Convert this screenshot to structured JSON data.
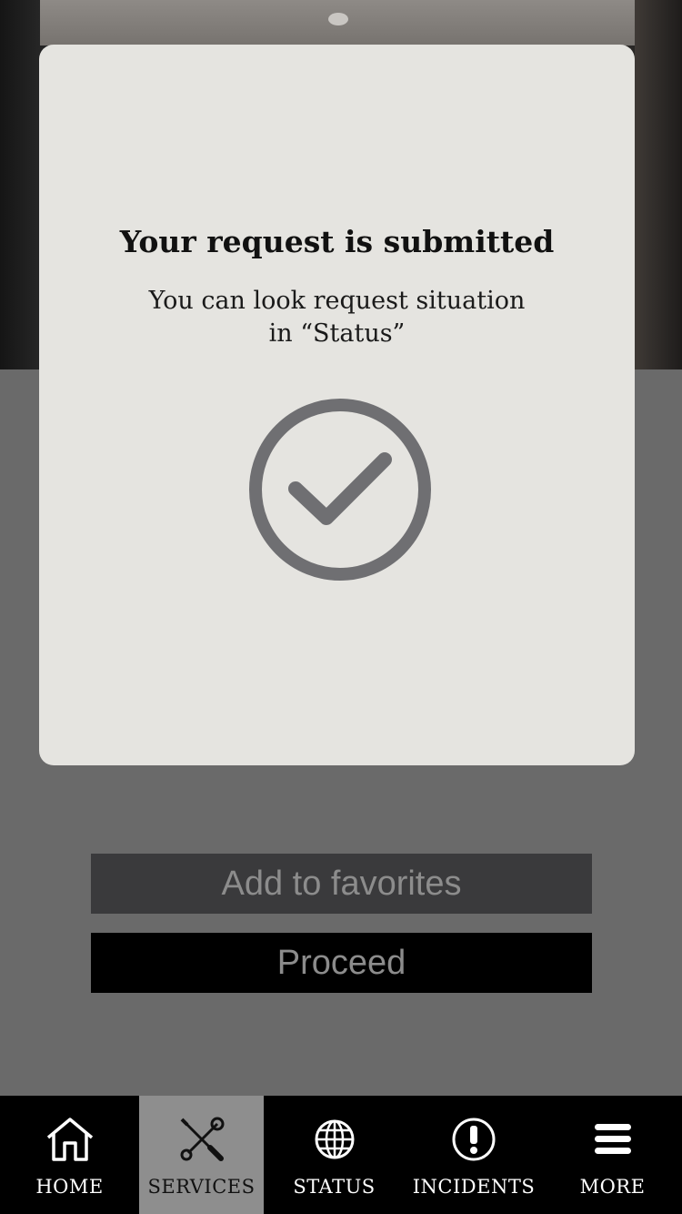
{
  "modal": {
    "title": "Your request is submitted",
    "message_line1": "You can look request situation",
    "message_line2": "in “Status”",
    "icon": "check-circle-icon"
  },
  "actions": {
    "favorites_label": "Add to favorites",
    "proceed_label": "Proceed"
  },
  "tabbar": {
    "items": [
      {
        "label": "HOME",
        "icon": "home-icon"
      },
      {
        "label": "SERVICES",
        "icon": "tools-icon",
        "active": true
      },
      {
        "label": "STATUS",
        "icon": "globe-icon"
      },
      {
        "label": "INCIDENTS",
        "icon": "alert-icon"
      },
      {
        "label": "MORE",
        "icon": "menu-icon"
      }
    ]
  },
  "colors": {
    "modal_bg": "#e5e4e0",
    "check_gray": "#6f6f72",
    "tabbar_bg": "#000000",
    "tab_active_bg": "#8e8e8e",
    "favorites_bg": "#3a3a3c",
    "proceed_bg": "#000000",
    "overlay_bg": "#6a6a6a"
  }
}
